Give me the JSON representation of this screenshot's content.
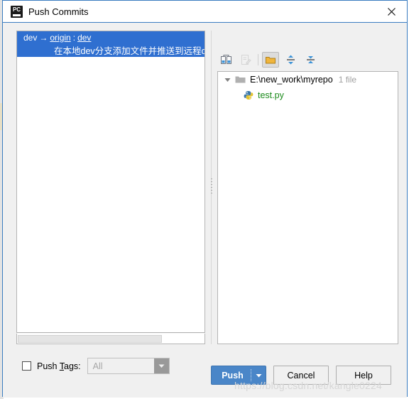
{
  "window": {
    "title": "Push Commits",
    "app_icon": "pycharm-icon",
    "app_icon_text": "PC",
    "close_icon": "close-icon",
    "border_color": "#3a7cc0"
  },
  "commits": {
    "selected_row": {
      "source_branch": "dev",
      "arrow": "→",
      "remote": "origin",
      "colon": ":",
      "target_branch": "dev"
    },
    "message": "在本地dev分支添加文件并推送到远程dev分支",
    "selection_color": "#2f6fd0"
  },
  "file_toolbar": {
    "buttons": [
      {
        "name": "show-diff-icon",
        "label": "Show Diff",
        "enabled": true,
        "toggled": false
      },
      {
        "name": "edit-source-icon",
        "label": "Edit Source",
        "enabled": false,
        "toggled": false
      },
      {
        "name": "group-by-directory-icon",
        "label": "Group By Directory",
        "enabled": true,
        "toggled": true
      },
      {
        "name": "expand-all-icon",
        "label": "Expand All",
        "enabled": true,
        "toggled": false
      },
      {
        "name": "collapse-all-icon",
        "label": "Collapse All",
        "enabled": true,
        "toggled": false
      }
    ]
  },
  "file_tree": {
    "directory": {
      "path": "E:\\new_work\\myrepo",
      "count_label": "1 file",
      "expanded": true,
      "icon": "folder-icon",
      "toggle_icon": "triangle-down-icon"
    },
    "files": [
      {
        "name": "test.py",
        "icon": "python-file-icon",
        "status_color": "#1a8a1a"
      }
    ]
  },
  "push_tags": {
    "label_before": "Push ",
    "label_mnemonic": "T",
    "label_after": "ags:",
    "checked": false,
    "combo_value": "All",
    "combo_enabled": false
  },
  "buttons": {
    "push": "Push",
    "push_dropdown_icon": "chevron-down-icon",
    "push_color": "#4a86c8",
    "cancel": "Cancel",
    "help": "Help"
  },
  "watermark": {
    "text": "https://blog.csdn.net/kangle0224"
  }
}
